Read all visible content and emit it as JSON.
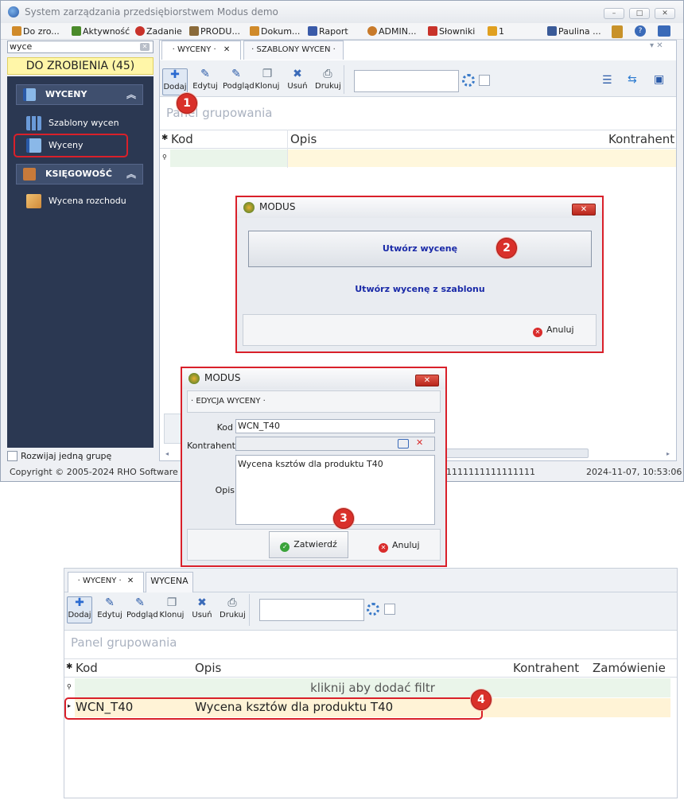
{
  "app": {
    "title": "System zarządzania przedsiębiorstwem Modus demo",
    "window_buttons": [
      "–",
      "□",
      "✕"
    ]
  },
  "quickbar": [
    {
      "label": "Do zro...",
      "icon": "pencil-icon",
      "color": "#d08a2a"
    },
    {
      "label": "Aktywność",
      "icon": "chart-icon",
      "color": "#4a8a2a"
    },
    {
      "label": "Zadanie",
      "icon": "clock-icon",
      "color": "#c8322a"
    },
    {
      "label": "PRODU...",
      "icon": "house-icon",
      "color": "#8a6a3a"
    },
    {
      "label": "Dokum...",
      "icon": "pencil-icon",
      "color": "#d08a2a"
    },
    {
      "label": "Raport",
      "icon": "bars-icon",
      "color": "#3a5aa8"
    },
    {
      "label": "ADMIN...",
      "icon": "user-icon",
      "color": "#c87a2a"
    },
    {
      "label": "Słowniki",
      "icon": "calendar-icon",
      "color": "#c8322a"
    },
    {
      "label": "1",
      "icon": "battery-icon",
      "color": "#e0a020"
    },
    {
      "label": "Paulina ...",
      "icon": "monitor-icon",
      "color": "#3a5a98"
    }
  ],
  "search": {
    "value": "wyce"
  },
  "todo": {
    "label": "DO ZROBIENIA (45)"
  },
  "sidebar": {
    "groups": [
      {
        "label": "WYCENY",
        "items": [
          "Szablony wycen",
          "Wyceny"
        ]
      },
      {
        "label": "KSIĘGOWOŚĆ",
        "items": [
          "Wycena rozchodu"
        ]
      }
    ],
    "expand_label": "Rozwijaj jedną grupę"
  },
  "tabs": {
    "active": "· WYCENY ·",
    "second": "· SZABLONY WYCEN ·"
  },
  "toolbar": [
    "Dodaj",
    "Edytuj",
    "Podgląd",
    "Klonuj",
    "Usuń",
    "Drukuj"
  ],
  "group_panel": "Panel grupowania",
  "grid": {
    "columns": [
      "Kod",
      "Opis",
      "Kontrahent"
    ]
  },
  "status": {
    "copyright": "Copyright © 2005-2024 RHO Software",
    "mid": "1111111111111111",
    "datetime": "2024-11-07,  10:53:06"
  },
  "dialog1": {
    "title": "MODUS",
    "option1": "Utwórz wycenę",
    "option2": "Utwórz wycenę z szablonu",
    "cancel": "Anuluj"
  },
  "dialog2": {
    "title": "MODUS",
    "section": "· EDYCJA WYCENY ·",
    "kod_label": "Kod",
    "kod_value": "WCN_T40",
    "kontrahent_label": "Kontrahent",
    "opis_label": "Opis",
    "opis_value": "Wycena ksztów dla produktu T40",
    "confirm": "Zatwierdź",
    "cancel": "Anuluj"
  },
  "bottom": {
    "tab1": "· WYCENY ·",
    "tab2": "WYCENA",
    "toolbar": [
      "Dodaj",
      "Edytuj",
      "Podgląd",
      "Klonuj",
      "Usuń",
      "Drukuj"
    ],
    "group_panel": "Panel grupowania",
    "columns": [
      "Kod",
      "Opis",
      "Kontrahent",
      "Zamówienie"
    ],
    "filter_hint": "kliknij aby dodać filtr",
    "row": {
      "kod": "WCN_T40",
      "opis": "Wycena ksztów dla produktu T40"
    }
  },
  "badges": [
    "1",
    "2",
    "3",
    "4"
  ]
}
